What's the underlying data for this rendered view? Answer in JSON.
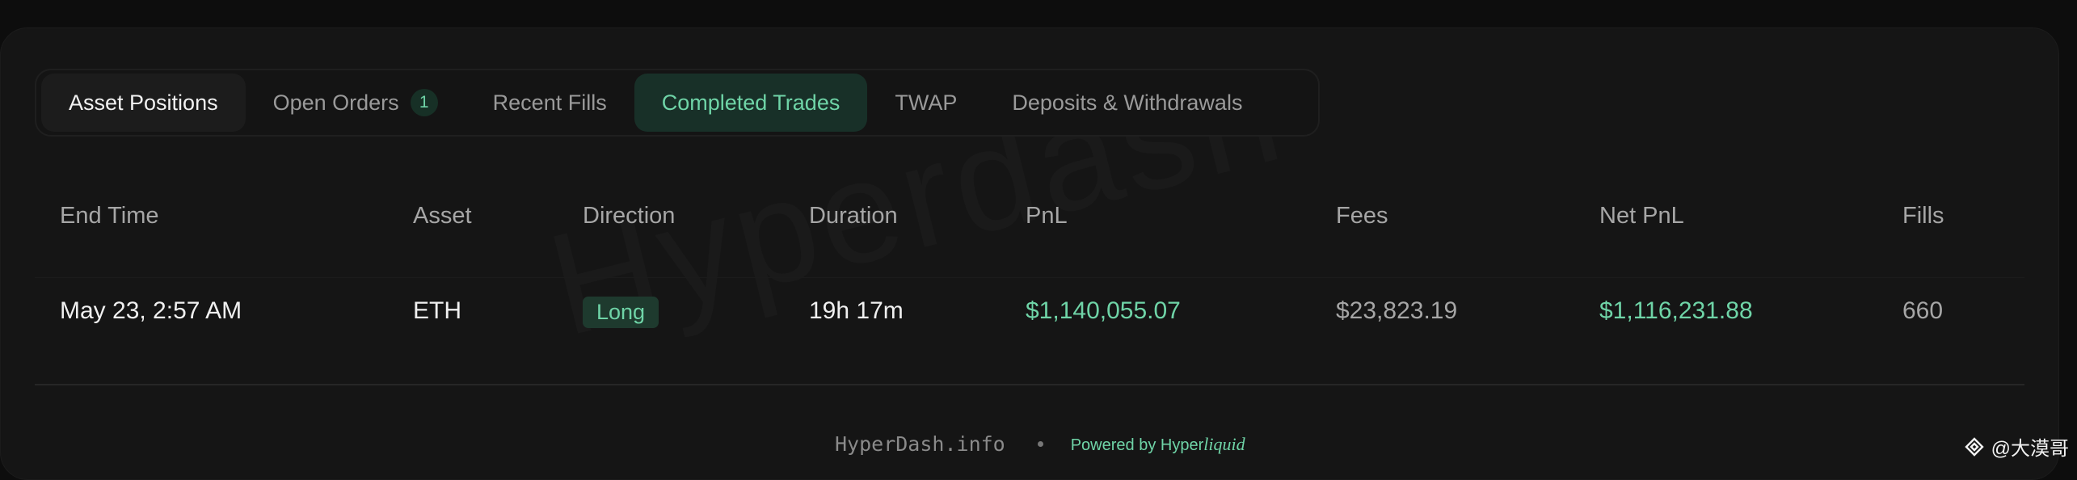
{
  "tabs": [
    {
      "label": "Asset Positions"
    },
    {
      "label": "Open Orders",
      "badge": "1"
    },
    {
      "label": "Recent Fills"
    },
    {
      "label": "Completed Trades"
    },
    {
      "label": "TWAP"
    },
    {
      "label": "Deposits & Withdrawals"
    }
  ],
  "active_tab": "Completed Trades",
  "watermark": "Hyperdash",
  "table": {
    "columns": [
      "End Time",
      "Asset",
      "Direction",
      "Duration",
      "PnL",
      "Fees",
      "Net PnL",
      "Fills"
    ],
    "rows": [
      {
        "end_time": "May 23, 2:57 AM",
        "asset": "ETH",
        "direction": "Long",
        "duration": "19h 17m",
        "pnl": "$1,140,055.07",
        "fees": "$23,823.19",
        "net_pnl": "$1,116,231.88",
        "fills": "660"
      }
    ]
  },
  "footer": {
    "site": "HyperDash.info",
    "powered_prefix": "Powered by Hyper",
    "powered_suffix": "liquid"
  },
  "credit": {
    "text": "@大漠哥",
    "icon": "binance-icon"
  },
  "colors": {
    "accent": "#6fd4a7",
    "background": "#151515"
  }
}
